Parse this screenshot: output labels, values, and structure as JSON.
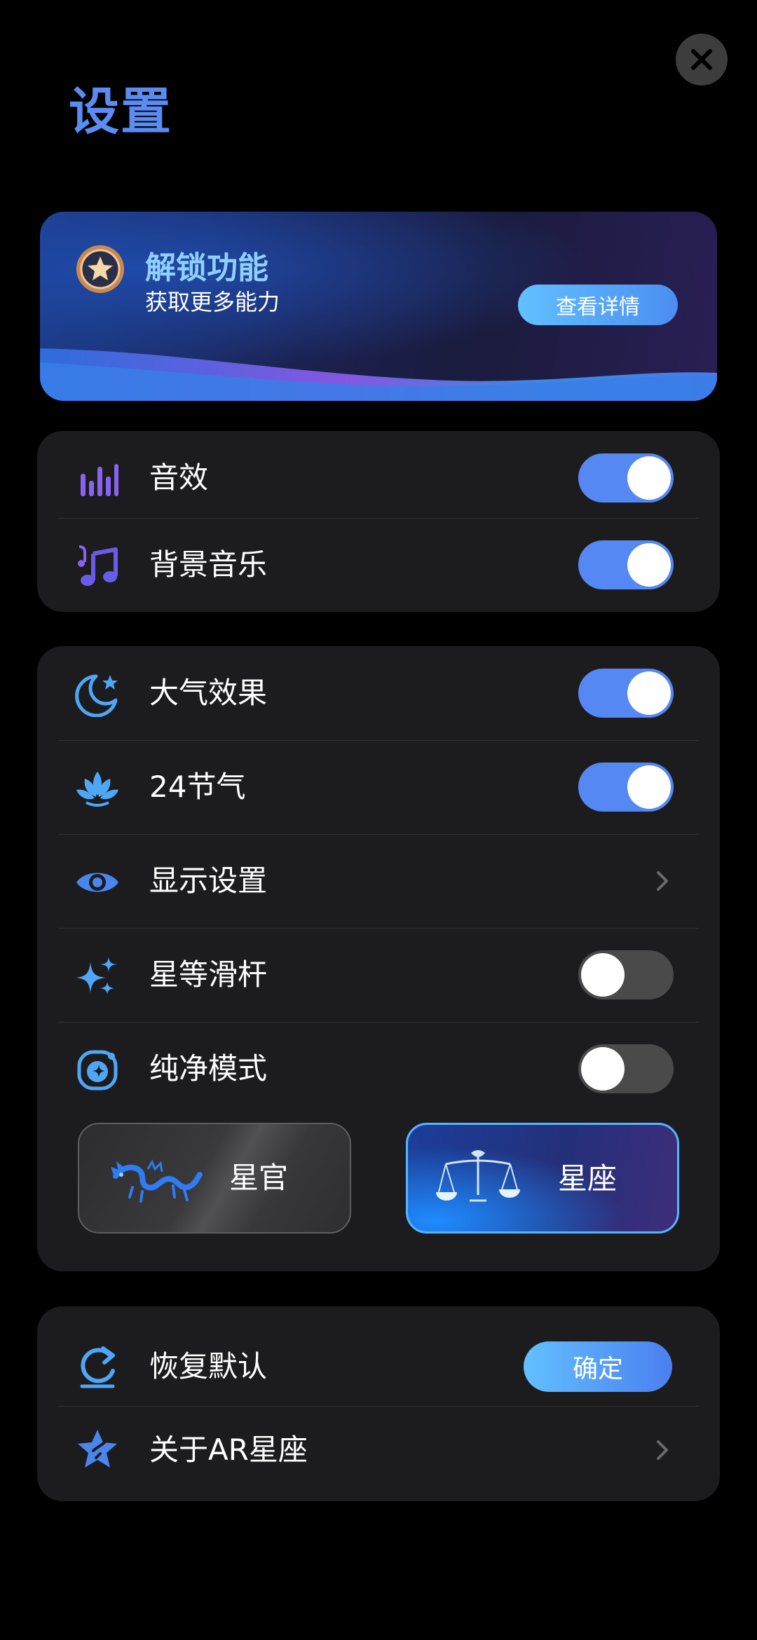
{
  "page": {
    "title": "设置",
    "close_icon": "close-icon"
  },
  "banner": {
    "title": "解锁功能",
    "subtitle": "获取更多能力",
    "button_label": "查看详情",
    "icon": "star-medal-icon"
  },
  "group1": {
    "items": [
      {
        "label": "音效",
        "icon": "equalizer-icon",
        "toggle_on": true
      },
      {
        "label": "背景音乐",
        "icon": "music-note-icon",
        "toggle_on": true
      }
    ]
  },
  "group2": {
    "items": [
      {
        "label": "大气效果",
        "icon": "moon-star-icon",
        "toggle_on": true
      },
      {
        "label": "24节气",
        "icon": "lotus-icon",
        "toggle_on": true
      },
      {
        "label": "显示设置",
        "icon": "eye-icon",
        "has_chevron": true
      },
      {
        "label": "星等滑杆",
        "icon": "sparkle-icon",
        "toggle_on": false
      },
      {
        "label": "纯净模式",
        "icon": "planet-icon",
        "toggle_on": false
      }
    ],
    "modes": [
      {
        "label": "星官",
        "icon": "dragon-icon",
        "selected": false
      },
      {
        "label": "星座",
        "icon": "libra-icon",
        "selected": true
      }
    ]
  },
  "group3": {
    "items": [
      {
        "label": "恢复默认",
        "icon": "refresh-icon",
        "button_label": "确定"
      },
      {
        "label": "关于AR星座",
        "icon": "star-badge-icon",
        "has_chevron": true
      }
    ]
  },
  "colors": {
    "accent": "#5588f2",
    "toggle_off": "#4a4a4a",
    "card": "#1c1c1e"
  }
}
